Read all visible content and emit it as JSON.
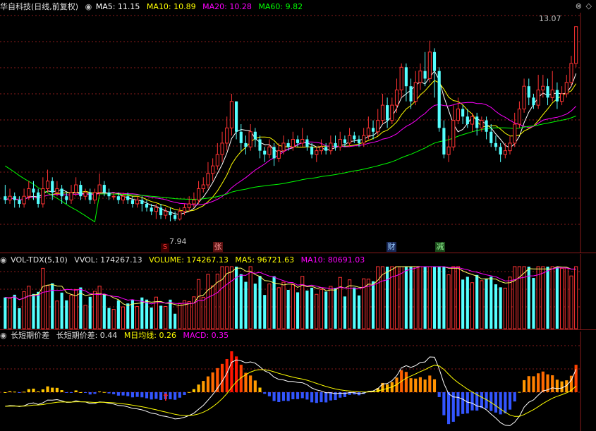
{
  "main_panel": {
    "title": "华自科技(日线,前复权)",
    "ma5_label": "MA5: 11.15",
    "ma10_label": "MA10: 10.89",
    "ma20_label": "MA20: 10.28",
    "ma60_label": "MA60: 9.82",
    "high_label": "13.07",
    "low_label": "7.94",
    "markers": [
      "S",
      "张",
      "财",
      "减"
    ],
    "colors": {
      "up": "#ff3333",
      "down": "#54ffff",
      "ma5": "#ffffff",
      "ma10": "#ffff00",
      "ma20": "#ff00ff",
      "ma60": "#00ff00",
      "grid": "#8a1b1b"
    }
  },
  "volume_panel": {
    "indicator": "VOL-TDX(5,10)",
    "vvol_label": "VVOL: 174267.13",
    "volume_label": "VOLUME: 174267.13",
    "ma5_label": "MA5: 96721.63",
    "ma10_label": "MA10: 80691.03"
  },
  "diff_panel": {
    "indicator": "长短期价差",
    "diff_label": "长短期价差: 0.44",
    "mline_label": "M日均线: 0.26",
    "macd_label": "MACD: 0.35",
    "arrow_icon": "up-arrow-icon"
  },
  "window_icons": [
    "close-icon",
    "diamond-icon"
  ],
  "chart_data": {
    "type": "candlestick",
    "candles": [
      [
        8.6,
        8.5,
        8.9,
        8.4
      ],
      [
        8.5,
        8.6,
        8.8,
        8.4
      ],
      [
        8.6,
        8.5,
        8.7,
        8.3
      ],
      [
        8.5,
        8.4,
        8.6,
        8.3
      ],
      [
        8.4,
        8.6,
        8.8,
        8.3
      ],
      [
        8.6,
        8.8,
        9.0,
        8.5
      ],
      [
        8.8,
        8.7,
        9.0,
        8.5
      ],
      [
        8.7,
        8.4,
        8.8,
        8.3
      ],
      [
        8.4,
        8.8,
        9.1,
        8.3
      ],
      [
        8.8,
        9.0,
        9.3,
        8.7
      ],
      [
        9.0,
        8.7,
        9.1,
        8.5
      ],
      [
        8.7,
        8.8,
        9.0,
        8.6
      ],
      [
        8.8,
        8.6,
        8.9,
        8.4
      ],
      [
        8.6,
        8.5,
        8.7,
        8.4
      ],
      [
        8.5,
        8.7,
        8.9,
        8.4
      ],
      [
        8.7,
        8.9,
        9.1,
        8.6
      ],
      [
        8.9,
        8.6,
        9.0,
        8.5
      ],
      [
        8.6,
        8.7,
        8.8,
        8.5
      ],
      [
        8.7,
        8.5,
        8.8,
        8.4
      ],
      [
        8.5,
        8.7,
        8.8,
        8.4
      ],
      [
        8.7,
        8.9,
        9.2,
        8.6
      ],
      [
        8.9,
        8.7,
        9.0,
        8.6
      ],
      [
        8.7,
        8.6,
        8.8,
        8.5
      ],
      [
        8.6,
        8.6,
        8.7,
        8.5
      ],
      [
        8.6,
        8.5,
        8.7,
        8.4
      ],
      [
        8.5,
        8.6,
        8.7,
        8.4
      ],
      [
        8.6,
        8.5,
        8.7,
        8.4
      ],
      [
        8.5,
        8.4,
        8.6,
        8.3
      ],
      [
        8.4,
        8.5,
        8.6,
        8.3
      ],
      [
        8.5,
        8.4,
        8.6,
        8.2
      ],
      [
        8.4,
        8.3,
        8.5,
        8.2
      ],
      [
        8.3,
        8.2,
        8.4,
        8.1
      ],
      [
        8.2,
        8.3,
        8.4,
        8.0
      ],
      [
        8.3,
        8.1,
        8.4,
        8.0
      ],
      [
        8.1,
        8.2,
        8.3,
        8.0
      ],
      [
        8.2,
        8.1,
        8.3,
        7.94
      ],
      [
        8.1,
        8.0,
        8.2,
        7.95
      ],
      [
        8.0,
        8.2,
        8.3,
        7.96
      ],
      [
        8.2,
        8.3,
        8.4,
        8.1
      ],
      [
        8.3,
        8.4,
        8.6,
        8.2
      ],
      [
        8.4,
        8.5,
        8.7,
        8.3
      ],
      [
        8.5,
        8.8,
        9.0,
        8.4
      ],
      [
        8.8,
        8.9,
        9.1,
        8.7
      ],
      [
        8.9,
        9.2,
        9.5,
        8.8
      ],
      [
        9.2,
        9.4,
        9.6,
        9.0
      ],
      [
        9.4,
        9.7,
        10.0,
        9.3
      ],
      [
        9.7,
        10.0,
        10.3,
        9.5
      ],
      [
        10.0,
        10.4,
        10.7,
        9.8
      ],
      [
        10.4,
        11.1,
        11.3,
        10.2
      ],
      [
        11.1,
        10.3,
        11.1,
        10.1
      ],
      [
        10.3,
        10.0,
        10.5,
        9.8
      ],
      [
        10.0,
        9.9,
        10.2,
        9.7
      ],
      [
        9.9,
        10.3,
        10.5,
        9.8
      ],
      [
        10.3,
        10.1,
        10.4,
        9.9
      ],
      [
        10.1,
        9.8,
        10.2,
        9.6
      ],
      [
        9.8,
        9.7,
        9.9,
        9.5
      ],
      [
        9.7,
        9.9,
        10.1,
        9.6
      ],
      [
        9.9,
        9.6,
        10.0,
        9.4
      ],
      [
        9.6,
        9.8,
        10.0,
        9.5
      ],
      [
        9.8,
        10.0,
        10.2,
        9.7
      ],
      [
        10.0,
        9.9,
        10.1,
        9.8
      ],
      [
        9.9,
        10.1,
        10.3,
        9.8
      ],
      [
        10.1,
        10.0,
        10.2,
        9.9
      ],
      [
        10.0,
        10.1,
        10.4,
        9.9
      ],
      [
        10.1,
        9.9,
        10.2,
        9.8
      ],
      [
        9.9,
        9.7,
        10.0,
        9.6
      ],
      [
        9.7,
        9.8,
        9.9,
        9.5
      ],
      [
        9.8,
        9.9,
        10.1,
        9.7
      ],
      [
        9.9,
        9.8,
        10.0,
        9.7
      ],
      [
        9.8,
        10.0,
        10.2,
        9.7
      ],
      [
        10.0,
        9.9,
        10.2,
        9.8
      ],
      [
        9.9,
        10.1,
        10.3,
        9.8
      ],
      [
        10.1,
        10.0,
        10.2,
        9.9
      ],
      [
        10.0,
        10.2,
        10.4,
        9.9
      ],
      [
        10.2,
        10.1,
        10.3,
        10.0
      ],
      [
        10.1,
        10.0,
        10.2,
        9.9
      ],
      [
        10.0,
        10.2,
        10.4,
        9.9
      ],
      [
        10.2,
        10.4,
        10.7,
        10.1
      ],
      [
        10.4,
        10.3,
        10.6,
        10.1
      ],
      [
        10.3,
        10.6,
        10.9,
        10.2
      ],
      [
        10.6,
        11.0,
        11.3,
        10.5
      ],
      [
        11.0,
        10.6,
        11.2,
        10.4
      ],
      [
        10.6,
        11.0,
        11.2,
        10.5
      ],
      [
        11.0,
        11.4,
        11.7,
        10.8
      ],
      [
        11.4,
        12.0,
        12.1,
        11.2
      ],
      [
        12.0,
        11.5,
        12.1,
        11.1
      ],
      [
        11.5,
        11.1,
        11.7,
        10.9
      ],
      [
        11.1,
        11.6,
        11.9,
        11.0
      ],
      [
        11.6,
        11.9,
        12.1,
        11.4
      ],
      [
        11.9,
        11.7,
        12.4,
        11.5
      ],
      [
        11.7,
        12.4,
        12.7,
        11.6
      ],
      [
        12.4,
        11.9,
        12.5,
        11.2
      ],
      [
        11.9,
        10.4,
        12.0,
        10.3
      ],
      [
        10.4,
        9.7,
        10.6,
        9.6
      ],
      [
        9.7,
        9.9,
        10.2,
        9.5
      ],
      [
        9.9,
        10.6,
        11.0,
        9.8
      ],
      [
        10.6,
        10.9,
        11.2,
        10.5
      ],
      [
        10.9,
        10.7,
        11.0,
        10.5
      ],
      [
        10.7,
        10.5,
        10.9,
        10.4
      ],
      [
        10.5,
        10.7,
        10.8,
        10.3
      ],
      [
        10.7,
        10.4,
        10.8,
        10.2
      ],
      [
        10.4,
        10.6,
        10.7,
        10.3
      ],
      [
        10.6,
        10.3,
        10.7,
        10.1
      ],
      [
        10.3,
        10.0,
        10.5,
        9.9
      ],
      [
        10.0,
        9.9,
        10.2,
        9.8
      ],
      [
        9.9,
        9.7,
        10.0,
        9.5
      ],
      [
        9.7,
        9.8,
        10.0,
        9.6
      ],
      [
        9.8,
        10.0,
        10.2,
        9.7
      ],
      [
        10.0,
        10.5,
        10.8,
        9.9
      ],
      [
        10.5,
        10.9,
        11.1,
        10.4
      ],
      [
        10.9,
        11.5,
        11.7,
        10.8
      ],
      [
        11.5,
        11.2,
        11.7,
        11.0
      ],
      [
        11.2,
        11.0,
        11.3,
        10.9
      ],
      [
        11.0,
        11.4,
        11.8,
        10.9
      ],
      [
        11.4,
        11.5,
        11.8,
        11.2
      ],
      [
        11.5,
        11.2,
        11.7,
        11.0
      ],
      [
        11.2,
        11.4,
        11.9,
        11.1
      ],
      [
        11.4,
        11.1,
        11.6,
        10.9
      ],
      [
        11.1,
        11.3,
        11.5,
        11.0
      ],
      [
        11.3,
        11.6,
        11.8,
        11.2
      ],
      [
        11.6,
        12.1,
        12.3,
        11.5
      ],
      [
        12.1,
        13.07,
        13.07,
        12.0
      ]
    ],
    "volume_ma5": 96721.63,
    "volume_ma10": 80691.03,
    "last_volume": 174267.13,
    "diff_last": 0.44,
    "signal_last": 0.26,
    "macd_last": 0.35,
    "ylim_price": [
      7.6,
      13.4
    ]
  }
}
